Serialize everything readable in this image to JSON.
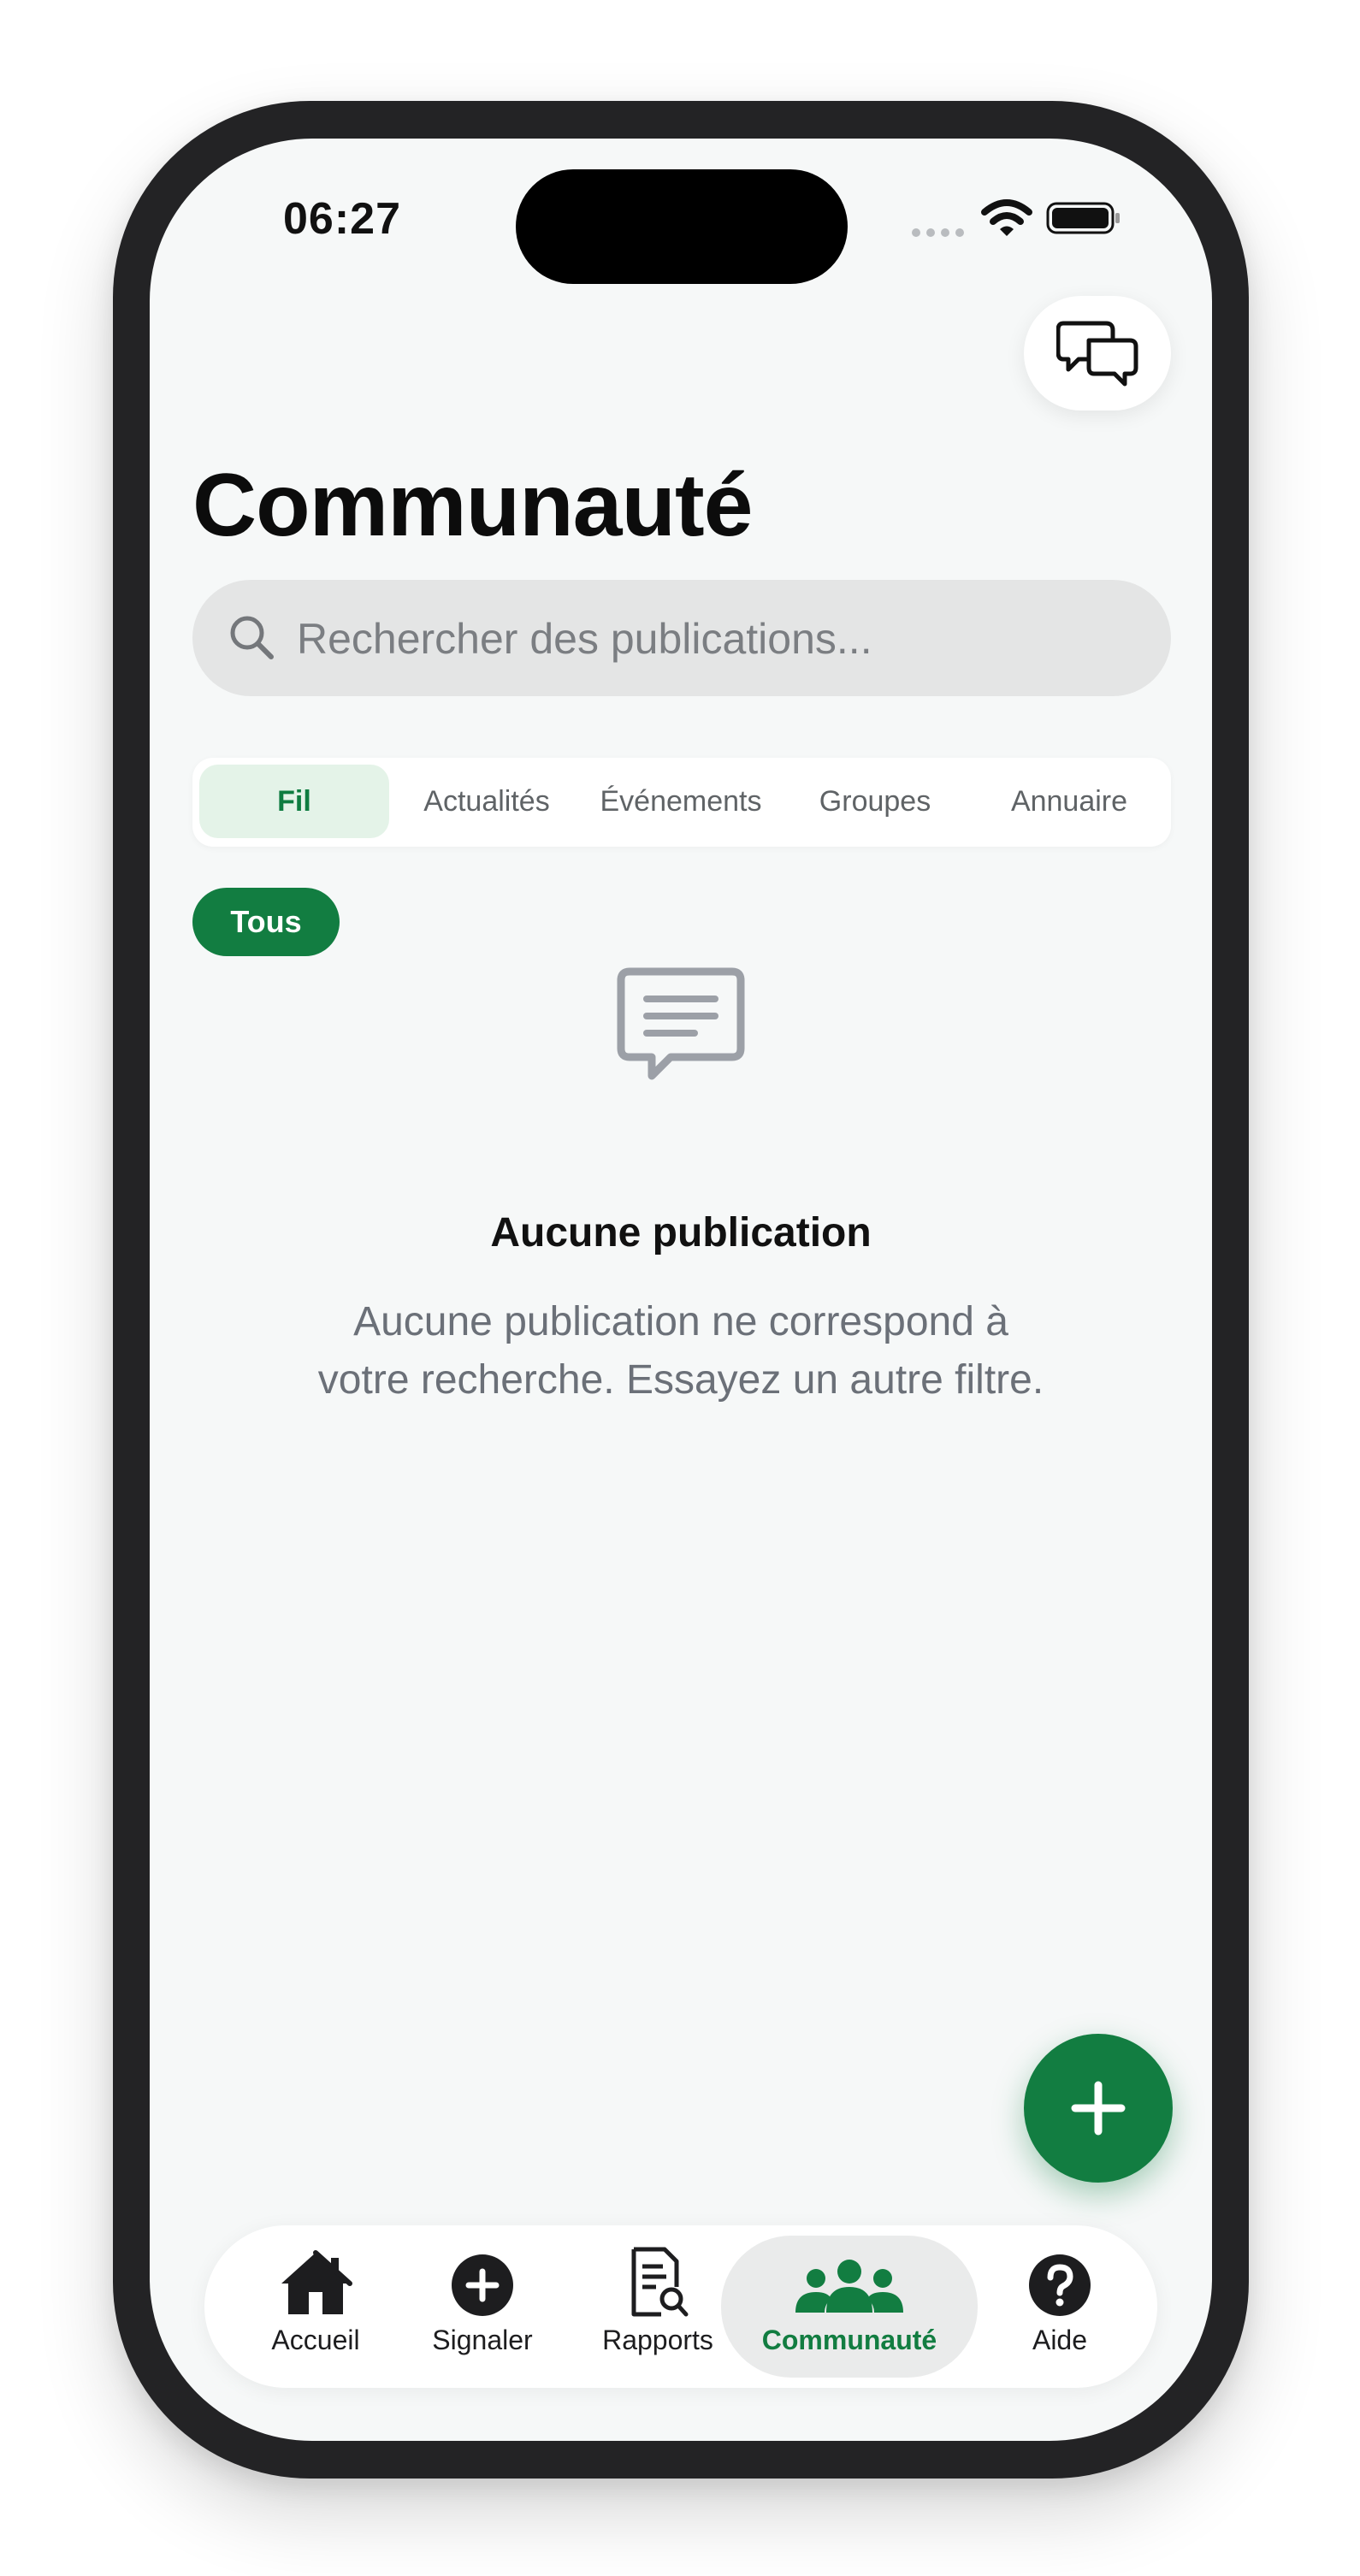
{
  "status_bar": {
    "time": "06:27"
  },
  "header": {
    "title": "Communauté",
    "chat_icon": "chat-bubbles-icon"
  },
  "search": {
    "placeholder": "Rechercher des publications..."
  },
  "tabs": [
    {
      "label": "Fil",
      "active": true
    },
    {
      "label": "Actualités",
      "active": false
    },
    {
      "label": "Événements",
      "active": false
    },
    {
      "label": "Groupes",
      "active": false
    },
    {
      "label": "Annuaire",
      "active": false
    }
  ],
  "filter": {
    "chip_label": "Tous"
  },
  "empty_state": {
    "title": "Aucune publication",
    "message": "Aucune publication ne correspond à votre recherche. Essayez un autre filtre."
  },
  "nav": [
    {
      "label": "Accueil",
      "icon": "home-icon",
      "active": false
    },
    {
      "label": "Signaler",
      "icon": "plus-circle-icon",
      "active": false
    },
    {
      "label": "Rapports",
      "icon": "report-search-icon",
      "active": false
    },
    {
      "label": "Communauté",
      "icon": "people-icon",
      "active": true
    },
    {
      "label": "Aide",
      "icon": "help-icon",
      "active": false
    }
  ],
  "colors": {
    "accent": "#127d41",
    "accent_light": "#e4f3e8",
    "background": "#f6f8f8",
    "text_muted": "#6b7078"
  }
}
